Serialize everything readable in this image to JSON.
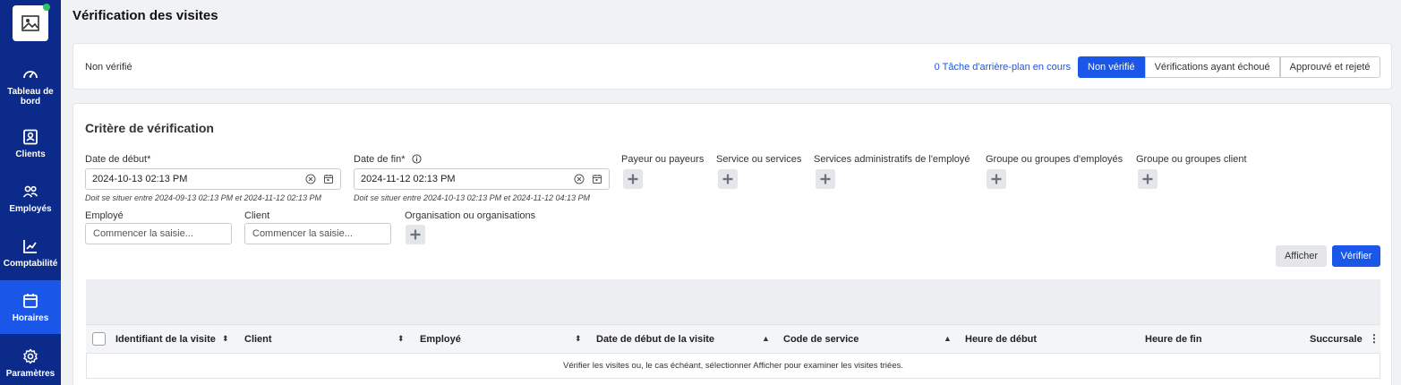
{
  "page": {
    "title": "Vérification des visites"
  },
  "sidebar": {
    "items": [
      {
        "label": "Tableau de bord",
        "icon": "gauge-icon"
      },
      {
        "label": "Clients",
        "icon": "contact-card-icon"
      },
      {
        "label": "Employés",
        "icon": "users-icon"
      },
      {
        "label": "Comptabilité",
        "icon": "chart-line-icon"
      },
      {
        "label": "Horaires",
        "icon": "calendar-icon",
        "active": true
      },
      {
        "label": "Paramètres",
        "icon": "gear-icon"
      }
    ]
  },
  "status_bar": {
    "label": "Non vérifié",
    "background_tasks": "0 Tâche d'arrière-plan en cours",
    "tabs": [
      {
        "label": "Non vérifié",
        "active": true
      },
      {
        "label": "Vérifications ayant échoué"
      },
      {
        "label": "Approuvé et rejeté"
      }
    ]
  },
  "criteria": {
    "title": "Critère de vérification",
    "start_date": {
      "label": "Date de début",
      "required": "*",
      "value": "2024-10-13 02:13 PM",
      "hint": "Doit se situer entre 2024-09-13 02:13 PM et 2024-11-12 02:13 PM"
    },
    "end_date": {
      "label": "Date de fin",
      "required": "*",
      "value": "2024-11-12 02:13 PM",
      "hint": "Doit se situer entre 2024-10-13 02:13 PM et 2024-11-12 04:13 PM"
    },
    "multi_fields": [
      "Payeur ou payeurs",
      "Service ou services",
      "Services administratifs de l'employé",
      "Groupe ou groupes d'employés",
      "Groupe ou groupes client"
    ],
    "employee": {
      "label": "Employé",
      "placeholder": "Commencer la saisie..."
    },
    "client": {
      "label": "Client",
      "placeholder": "Commencer la saisie..."
    },
    "organisations": {
      "label": "Organisation ou organisations"
    },
    "show_button": "Afficher",
    "verify_button": "Vérifier"
  },
  "table": {
    "columns": [
      "Identifiant de la visite",
      "Client",
      "Employé",
      "Date de début de la visite",
      "Code de service",
      "Heure de début",
      "Heure de fin",
      "Succursale"
    ],
    "empty_message": "Vérifier les visites ou, le cas échéant, sélectionner Afficher pour examiner les visites triées."
  },
  "colors": {
    "sidebar": "#0b2a8a",
    "accent": "#1a56e8",
    "success": "#2ec26a"
  }
}
